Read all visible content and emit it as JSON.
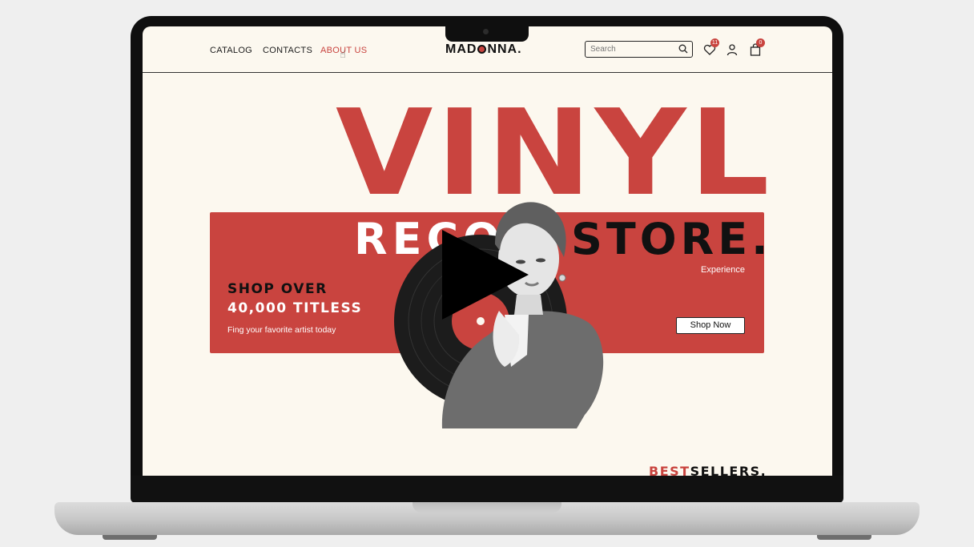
{
  "nav": {
    "links": [
      {
        "label": "CATALOG",
        "active": false
      },
      {
        "label": "CONTACTS",
        "active": false
      },
      {
        "label": "ABOUT US",
        "active": true
      }
    ]
  },
  "logo": {
    "part1": "MAD",
    "part2": "NNA."
  },
  "search": {
    "placeholder": "Search"
  },
  "header_icons": {
    "wishlist_count": "11",
    "cart_count": "0"
  },
  "hero": {
    "title": "VINYL",
    "record_word": "RECO",
    "store_word": "STORE.",
    "experience": "Experience",
    "shop_over": "SHOP OVER",
    "titles": "40,000 TITLESS",
    "tagline": "Fing your favorite artist today",
    "cta": "Shop Now"
  },
  "section": {
    "best": "BEST",
    "sellers": "SELLERS."
  },
  "colors": {
    "accent": "#c9443f",
    "page_bg": "#fcf8ef",
    "ink": "#111111"
  },
  "icons": [
    "search-icon",
    "heart-icon",
    "user-icon",
    "bag-icon",
    "play-icon",
    "pointer-cursor-icon"
  ]
}
